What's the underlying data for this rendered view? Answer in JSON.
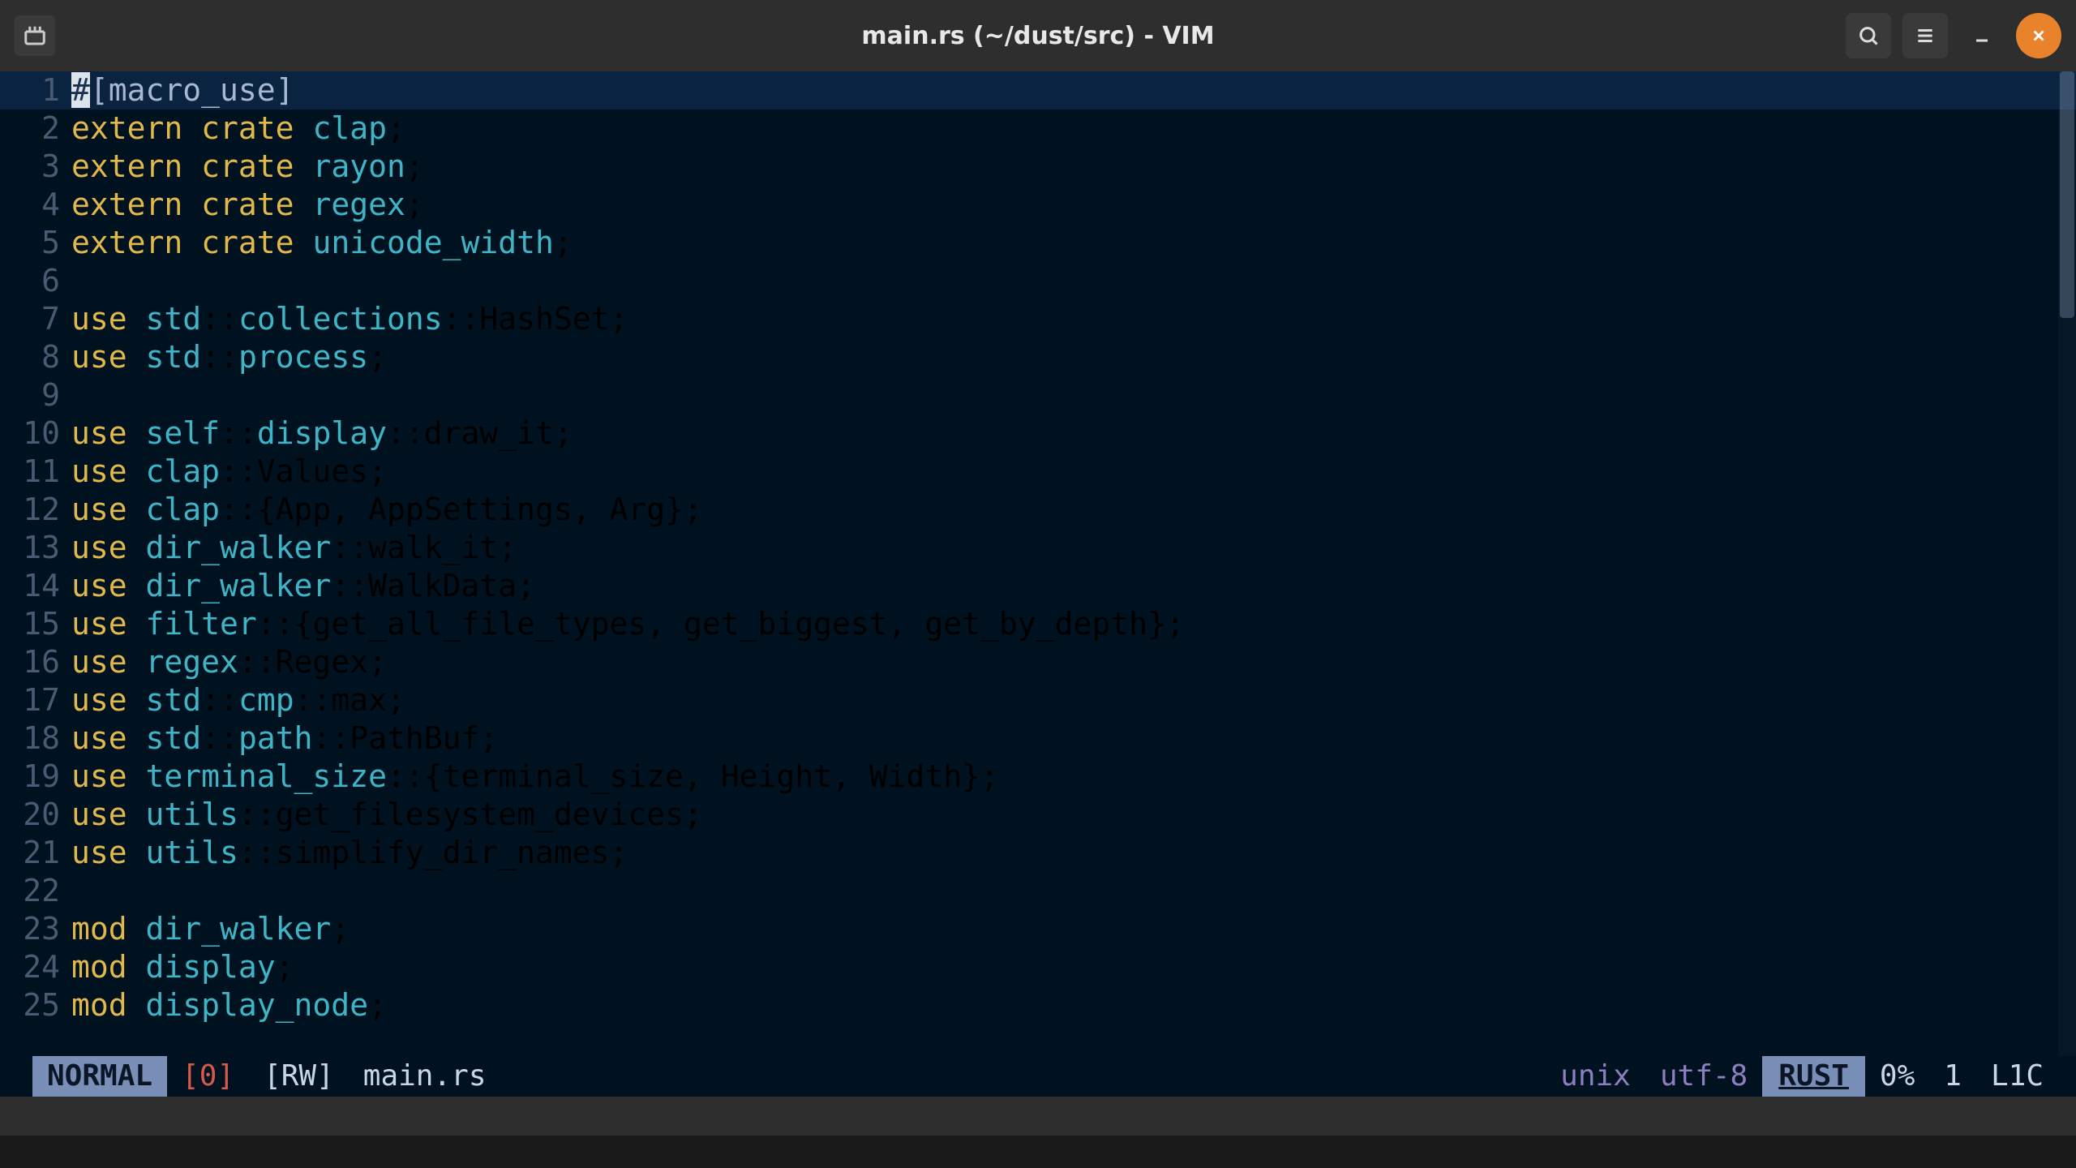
{
  "titlebar": {
    "title": "main.rs (~/dust/src) - VIM"
  },
  "status": {
    "mode": "NORMAL",
    "buffer_count": "[0]",
    "readwrite": "[RW]",
    "filename": "main.rs",
    "os": "unix",
    "encoding": "utf-8",
    "filetype": "RUST",
    "percent": "0%",
    "line": "1",
    "col": "L1C"
  },
  "code": {
    "lines": [
      {
        "n": 1,
        "current": true,
        "tokens": [
          {
            "t": "#",
            "cls": "cursor"
          },
          {
            "t": "[macro_use]",
            "cls": "attr"
          }
        ]
      },
      {
        "n": 2,
        "tokens": [
          {
            "t": "extern",
            "cls": "kw"
          },
          {
            "t": " "
          },
          {
            "t": "crate",
            "cls": "kw"
          },
          {
            "t": " "
          },
          {
            "t": "clap",
            "cls": "cr"
          },
          {
            "t": ";"
          }
        ]
      },
      {
        "n": 3,
        "tokens": [
          {
            "t": "extern",
            "cls": "kw"
          },
          {
            "t": " "
          },
          {
            "t": "crate",
            "cls": "kw"
          },
          {
            "t": " "
          },
          {
            "t": "rayon",
            "cls": "cr"
          },
          {
            "t": ";"
          }
        ]
      },
      {
        "n": 4,
        "tokens": [
          {
            "t": "extern",
            "cls": "kw"
          },
          {
            "t": " "
          },
          {
            "t": "crate",
            "cls": "kw"
          },
          {
            "t": " "
          },
          {
            "t": "regex",
            "cls": "cr"
          },
          {
            "t": ";"
          }
        ]
      },
      {
        "n": 5,
        "tokens": [
          {
            "t": "extern",
            "cls": "kw"
          },
          {
            "t": " "
          },
          {
            "t": "crate",
            "cls": "kw"
          },
          {
            "t": " "
          },
          {
            "t": "unicode_width",
            "cls": "cr"
          },
          {
            "t": ";"
          }
        ]
      },
      {
        "n": 6,
        "tokens": []
      },
      {
        "n": 7,
        "tokens": [
          {
            "t": "use",
            "cls": "kw"
          },
          {
            "t": " "
          },
          {
            "t": "std",
            "cls": "cr"
          },
          {
            "t": "::"
          },
          {
            "t": "collections",
            "cls": "cr"
          },
          {
            "t": "::HashSet;"
          }
        ]
      },
      {
        "n": 8,
        "tokens": [
          {
            "t": "use",
            "cls": "kw"
          },
          {
            "t": " "
          },
          {
            "t": "std",
            "cls": "cr"
          },
          {
            "t": "::"
          },
          {
            "t": "process",
            "cls": "cr"
          },
          {
            "t": ";"
          }
        ]
      },
      {
        "n": 9,
        "tokens": []
      },
      {
        "n": 10,
        "tokens": [
          {
            "t": "use",
            "cls": "kw"
          },
          {
            "t": " "
          },
          {
            "t": "self",
            "cls": "cr"
          },
          {
            "t": "::"
          },
          {
            "t": "display",
            "cls": "cr"
          },
          {
            "t": "::draw_it;"
          }
        ]
      },
      {
        "n": 11,
        "tokens": [
          {
            "t": "use",
            "cls": "kw"
          },
          {
            "t": " "
          },
          {
            "t": "clap",
            "cls": "cr"
          },
          {
            "t": "::Values;"
          }
        ]
      },
      {
        "n": 12,
        "tokens": [
          {
            "t": "use",
            "cls": "kw"
          },
          {
            "t": " "
          },
          {
            "t": "clap",
            "cls": "cr"
          },
          {
            "t": "::{App, AppSettings, Arg};"
          }
        ]
      },
      {
        "n": 13,
        "tokens": [
          {
            "t": "use",
            "cls": "kw"
          },
          {
            "t": " "
          },
          {
            "t": "dir_walker",
            "cls": "cr"
          },
          {
            "t": "::walk_it;"
          }
        ]
      },
      {
        "n": 14,
        "tokens": [
          {
            "t": "use",
            "cls": "kw"
          },
          {
            "t": " "
          },
          {
            "t": "dir_walker",
            "cls": "cr"
          },
          {
            "t": "::WalkData;"
          }
        ]
      },
      {
        "n": 15,
        "tokens": [
          {
            "t": "use",
            "cls": "kw"
          },
          {
            "t": " "
          },
          {
            "t": "filter",
            "cls": "cr"
          },
          {
            "t": "::{get_all_file_types, get_biggest, get_by_depth};"
          }
        ]
      },
      {
        "n": 16,
        "tokens": [
          {
            "t": "use",
            "cls": "kw"
          },
          {
            "t": " "
          },
          {
            "t": "regex",
            "cls": "cr"
          },
          {
            "t": "::Regex;"
          }
        ]
      },
      {
        "n": 17,
        "tokens": [
          {
            "t": "use",
            "cls": "kw"
          },
          {
            "t": " "
          },
          {
            "t": "std",
            "cls": "cr"
          },
          {
            "t": "::"
          },
          {
            "t": "cmp",
            "cls": "cr"
          },
          {
            "t": "::max;"
          }
        ]
      },
      {
        "n": 18,
        "tokens": [
          {
            "t": "use",
            "cls": "kw"
          },
          {
            "t": " "
          },
          {
            "t": "std",
            "cls": "cr"
          },
          {
            "t": "::"
          },
          {
            "t": "path",
            "cls": "cr"
          },
          {
            "t": "::PathBuf;"
          }
        ]
      },
      {
        "n": 19,
        "tokens": [
          {
            "t": "use",
            "cls": "kw"
          },
          {
            "t": " "
          },
          {
            "t": "terminal_size",
            "cls": "cr"
          },
          {
            "t": "::{terminal_size, Height, Width};"
          }
        ]
      },
      {
        "n": 20,
        "tokens": [
          {
            "t": "use",
            "cls": "kw"
          },
          {
            "t": " "
          },
          {
            "t": "utils",
            "cls": "cr"
          },
          {
            "t": "::get_filesystem_devices;"
          }
        ]
      },
      {
        "n": 21,
        "tokens": [
          {
            "t": "use",
            "cls": "kw"
          },
          {
            "t": " "
          },
          {
            "t": "utils",
            "cls": "cr"
          },
          {
            "t": "::simplify_dir_names;"
          }
        ]
      },
      {
        "n": 22,
        "tokens": []
      },
      {
        "n": 23,
        "tokens": [
          {
            "t": "mod",
            "cls": "kw"
          },
          {
            "t": " "
          },
          {
            "t": "dir_walker",
            "cls": "cr"
          },
          {
            "t": ";"
          }
        ]
      },
      {
        "n": 24,
        "tokens": [
          {
            "t": "mod",
            "cls": "kw"
          },
          {
            "t": " "
          },
          {
            "t": "display",
            "cls": "cr"
          },
          {
            "t": ";"
          }
        ]
      },
      {
        "n": 25,
        "tokens": [
          {
            "t": "mod",
            "cls": "kw"
          },
          {
            "t": " "
          },
          {
            "t": "display_node",
            "cls": "cr"
          },
          {
            "t": ";"
          }
        ]
      }
    ]
  }
}
